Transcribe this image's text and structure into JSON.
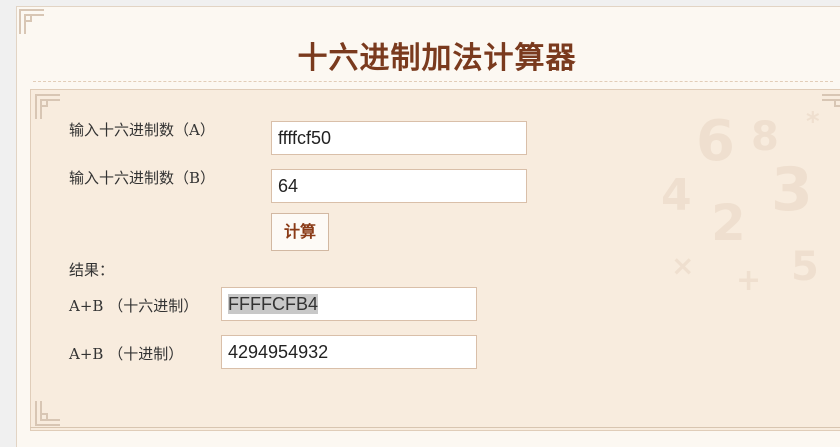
{
  "page": {
    "title": "十六进制加法计算器"
  },
  "form": {
    "label_a": "输入十六进制数（A）",
    "value_a": "ffffcf50",
    "label_b": "输入十六进制数（B）",
    "value_b": "64",
    "calc_button": "计算"
  },
  "result": {
    "heading": "结果：",
    "hex_label": "A+B （十六进制）",
    "hex_value": "FFFFCFB4",
    "dec_label": "A+B （十进制）",
    "dec_value": "4294954932"
  },
  "colors": {
    "accent": "#7a3a1e",
    "panel_bg": "#f8ecde",
    "page_bg": "#fcf8f2",
    "border": "#d9bfa9"
  }
}
